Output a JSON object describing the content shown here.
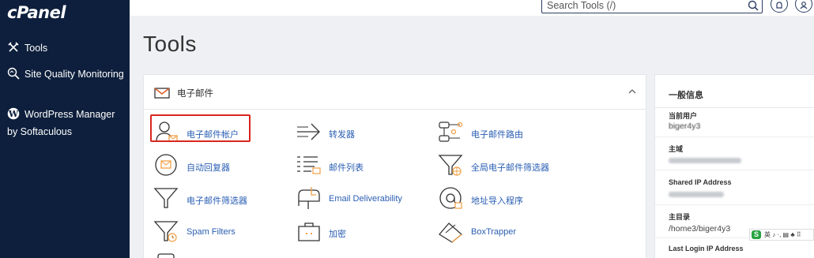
{
  "app": {
    "logo": "cPanel"
  },
  "sidebar": {
    "items": [
      {
        "label": "Tools",
        "icon": "tools-icon"
      },
      {
        "label": "Site Quality Monitoring",
        "icon": "site-quality-icon"
      },
      {
        "label": "WordPress Manager by Softaculous",
        "icon": "wordpress-icon"
      }
    ]
  },
  "header": {
    "search": {
      "placeholder": "Search Tools (/)",
      "value": ""
    }
  },
  "page": {
    "title": "Tools"
  },
  "email_panel": {
    "title": "电子邮件",
    "tools": [
      {
        "label": "电子邮件帐户",
        "icon": "email-accounts-icon"
      },
      {
        "label": "转发器",
        "icon": "forwarders-icon"
      },
      {
        "label": "电子邮件路由",
        "icon": "email-routing-icon"
      },
      {
        "label": "自动回复器",
        "icon": "autoresponders-icon"
      },
      {
        "label": "邮件列表",
        "icon": "mailing-lists-icon"
      },
      {
        "label": "全局电子邮件筛选器",
        "icon": "global-email-filters-icon"
      },
      {
        "label": "电子邮件筛选器",
        "icon": "email-filters-icon"
      },
      {
        "label": "Email Deliverability",
        "icon": "email-deliverability-icon"
      },
      {
        "label": "地址导入程序",
        "icon": "address-importer-icon"
      },
      {
        "label": "Spam Filters",
        "icon": "spam-filters-icon"
      },
      {
        "label": "加密",
        "icon": "encryption-icon"
      },
      {
        "label": "BoxTrapper",
        "icon": "boxtrapper-icon"
      }
    ]
  },
  "general_info": {
    "title": "一般信息",
    "current_user": {
      "label": "当前用户",
      "value": "biger4y3"
    },
    "primary_domain": {
      "label": "主域"
    },
    "shared_ip": {
      "label": "Shared IP Address"
    },
    "home_dir": {
      "label": "主目录",
      "value": "/home3/biger4y3"
    },
    "last_login": {
      "label": "Last Login IP Address"
    }
  },
  "ime_toolbar": {
    "text": "英 ♪ ·, ▤ ♣ ⠿"
  },
  "colors": {
    "sidebar_bg": "#0d1f3c",
    "link": "#2a5eb3",
    "highlight": "#d8261e",
    "accent_orange": "#f0a046"
  }
}
